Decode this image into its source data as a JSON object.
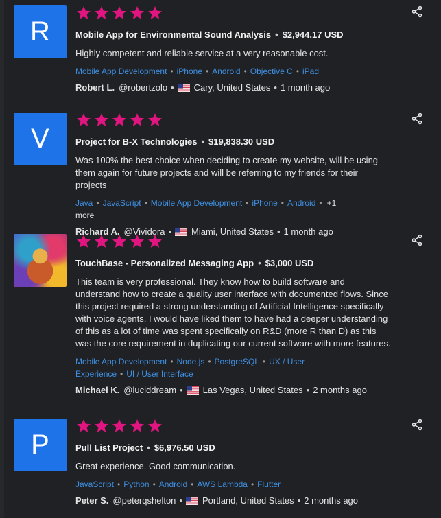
{
  "reviews": [
    {
      "avatar_letter": "R",
      "rating": 5,
      "project_title": "Mobile App for Environmental Sound Analysis",
      "amount": "$2,944.17 USD",
      "comment": "Highly competent and reliable service at a very reasonable cost.",
      "skills": [
        "Mobile App Development",
        "iPhone",
        "Android",
        "Objective C",
        "iPad"
      ],
      "more": "",
      "reviewer_name": "Robert L.",
      "reviewer_handle": "@robertzolo",
      "location": "Cary, United States",
      "time_ago": "1 month ago"
    },
    {
      "avatar_letter": "V",
      "rating": 5,
      "project_title": "Project for B-X Technologies",
      "amount": "$19,838.30 USD",
      "comment": "Was 100% the best choice when deciding to create my website, will be using them again for future projects and will be referring to my friends for their projects",
      "skills": [
        "Java",
        "JavaScript",
        "Mobile App Development",
        "iPhone",
        "Android"
      ],
      "more": "+1 more",
      "reviewer_name": "Richard A.",
      "reviewer_handle": "@Vividora",
      "location": "Miami, United States",
      "time_ago": "1 month ago"
    },
    {
      "avatar_letter": "",
      "rating": 5,
      "project_title": "TouchBase - Personalized Messaging App",
      "amount": "$3,000 USD",
      "comment": "This team is very professional. They know how to build software and understand how to create a quality user interface with documented flows. Since this project required a strong understanding of Artificial Intelligence specifically with voice agents, I would have liked them to have had a deeper understanding of this as a lot of time was spent specifically on R&D (more R than D) as this was the core requirement in duplicating our current software with more features.",
      "skills": [
        "Mobile App Development",
        "Node.js",
        "PostgreSQL",
        "UX / User Experience",
        "UI / User Interface"
      ],
      "more": "",
      "reviewer_name": "Michael K.",
      "reviewer_handle": "@luciddream",
      "location": "Las Vegas, United States",
      "time_ago": "2 months ago"
    },
    {
      "avatar_letter": "P",
      "rating": 5,
      "project_title": "Pull List Project",
      "amount": "$6,976.50 USD",
      "comment": "Great experience. Good communication.",
      "skills": [
        "JavaScript",
        "Python",
        "Android",
        "AWS Lambda",
        "Flutter"
      ],
      "more": "",
      "reviewer_name": "Peter S.",
      "reviewer_handle": "@peterqshelton",
      "location": "Portland, United States",
      "time_ago": "2 months ago"
    }
  ],
  "colors": {
    "star": "#e0157f",
    "link": "#3f8fe0",
    "avatar_bg": "#1e73e8",
    "background": "#1f2125"
  },
  "icons": {
    "share": "share-icon",
    "star": "star-icon",
    "flag": "us-flag-icon"
  }
}
